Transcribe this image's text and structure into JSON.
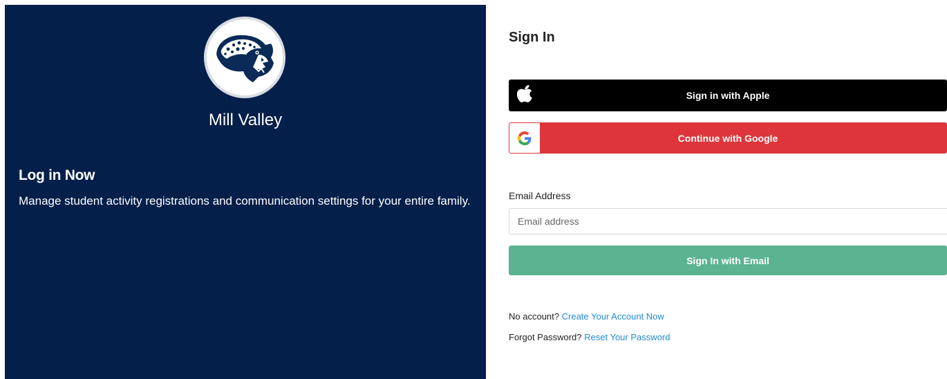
{
  "school": {
    "name": "Mill Valley",
    "logo_icon": "jaguar-mascot-icon"
  },
  "intro": {
    "heading": "Log in Now",
    "description": "Manage student activity registrations and communication settings for your entire family."
  },
  "signin": {
    "title": "Sign In",
    "apple_label": "Sign in with Apple",
    "google_label": "Continue with Google",
    "email_label": "Email Address",
    "email_placeholder": "Email address",
    "email_value": "",
    "email_button_label": "Sign In with Email"
  },
  "footer": {
    "no_account_text": "No account?",
    "create_link": "Create Your Account Now",
    "forgot_text": "Forgot Password?",
    "reset_link": "Reset Your Password"
  },
  "colors": {
    "panel": "#041f4a",
    "apple": "#000000",
    "google": "#dd353b",
    "email_button": "#5bb391",
    "link": "#1f8ad8"
  }
}
